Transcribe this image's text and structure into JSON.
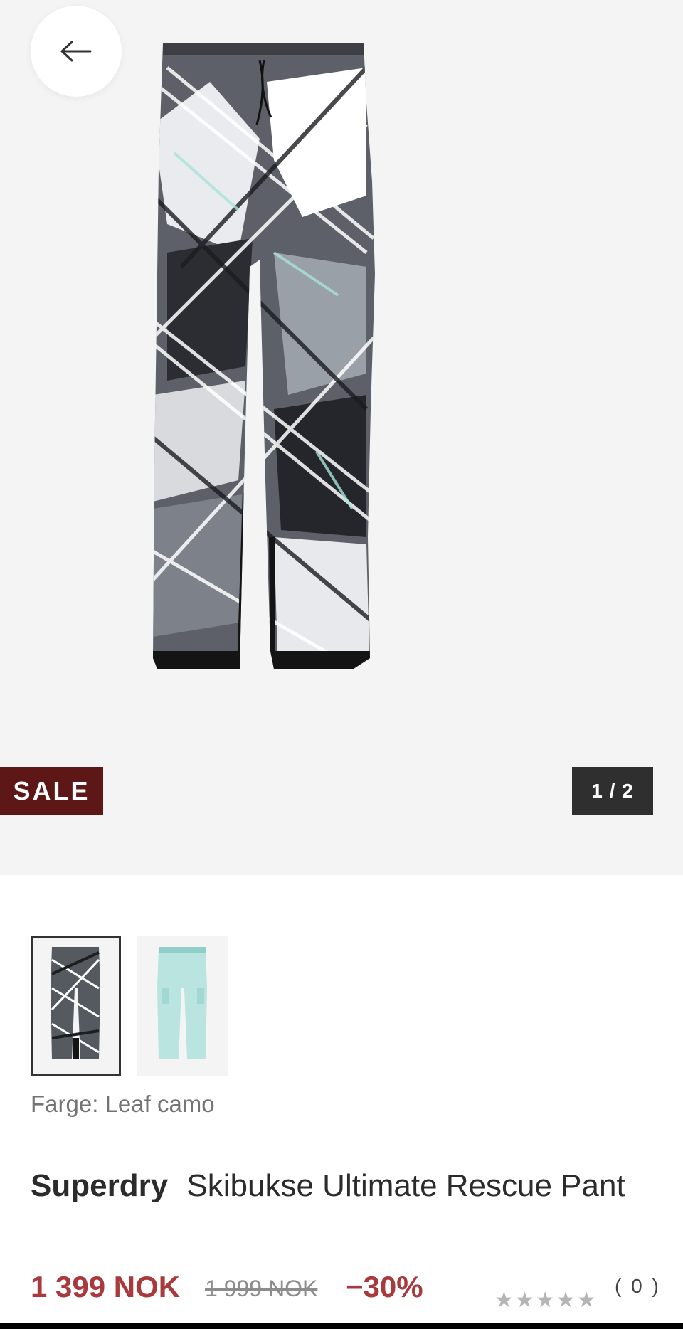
{
  "hero": {
    "sale_badge": "SALE",
    "pager": "1 / 2"
  },
  "icons": {
    "back": "arrow-left-icon",
    "stars": "star-icon"
  },
  "colors": {
    "sale_badge_bg": "#5d1717",
    "price": "#a8393c",
    "hero_bg": "#f4f4f4"
  },
  "variants": {
    "color_label": "Farge: Leaf camo",
    "thumbnails": [
      "Leaf camo",
      "Mint"
    ],
    "selected_index": 0
  },
  "product": {
    "brand": "Superdry",
    "name": "Skibukse Ultimate Rescue Pant",
    "price": "1 399 NOK",
    "old_price": "1 999 NOK",
    "discount": "−30%",
    "rating": {
      "stars": "★★★★★",
      "count": "( 0 )",
      "value": 0,
      "max": 5
    }
  }
}
